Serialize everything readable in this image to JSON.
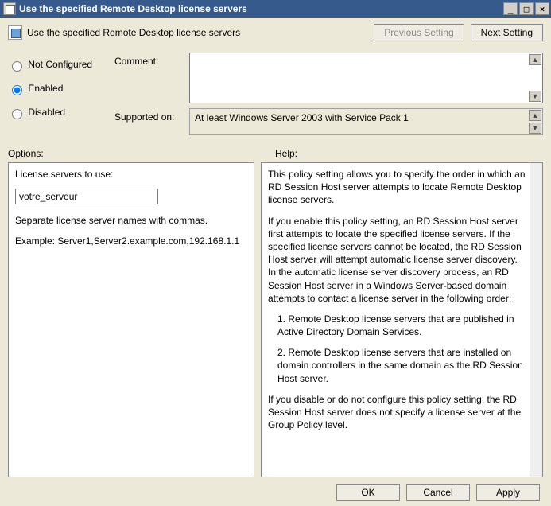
{
  "window": {
    "title": "Use the specified Remote Desktop license servers"
  },
  "header": {
    "policyTitle": "Use the specified Remote Desktop license servers",
    "prevSetting": "Previous Setting",
    "nextSetting": "Next Setting"
  },
  "state": {
    "options": [
      {
        "label": "Not Configured",
        "value": "notconf"
      },
      {
        "label": "Enabled",
        "value": "enabled"
      },
      {
        "label": "Disabled",
        "value": "disabled"
      }
    ],
    "selected": "enabled"
  },
  "labels": {
    "comment": "Comment:",
    "supportedOn": "Supported on:",
    "optionsHeading": "Options:",
    "helpHeading": "Help:"
  },
  "supported": {
    "text": "At least Windows Server 2003 with Service Pack 1"
  },
  "options": {
    "licenseServersLabel": "License servers to use:",
    "licenseServersValue": "votre_serveur",
    "separateHint": "Separate license server names with commas.",
    "exampleLabel": "Example: Server1,Server2.example.com,192.168.1.1"
  },
  "help": {
    "p1": "This policy setting allows you to specify the order in which an RD Session Host server attempts to locate Remote Desktop license servers.",
    "p2": "If you enable this policy setting, an RD Session Host server first attempts to locate the specified license servers. If the specified license servers cannot be located, the RD Session Host server will attempt automatic license server discovery. In the automatic license server discovery process, an RD Session Host server in a Windows Server-based domain attempts to contact a license server in the following order:",
    "p3": "1. Remote Desktop license servers that are published in Active Directory Domain Services.",
    "p4": "2. Remote Desktop license servers that are installed on domain controllers in the same domain as the RD Session Host server.",
    "p5": "If you disable or do not configure this policy setting, the RD Session Host server does not specify a license server at the Group Policy level."
  },
  "footer": {
    "ok": "OK",
    "cancel": "Cancel",
    "apply": "Apply"
  }
}
